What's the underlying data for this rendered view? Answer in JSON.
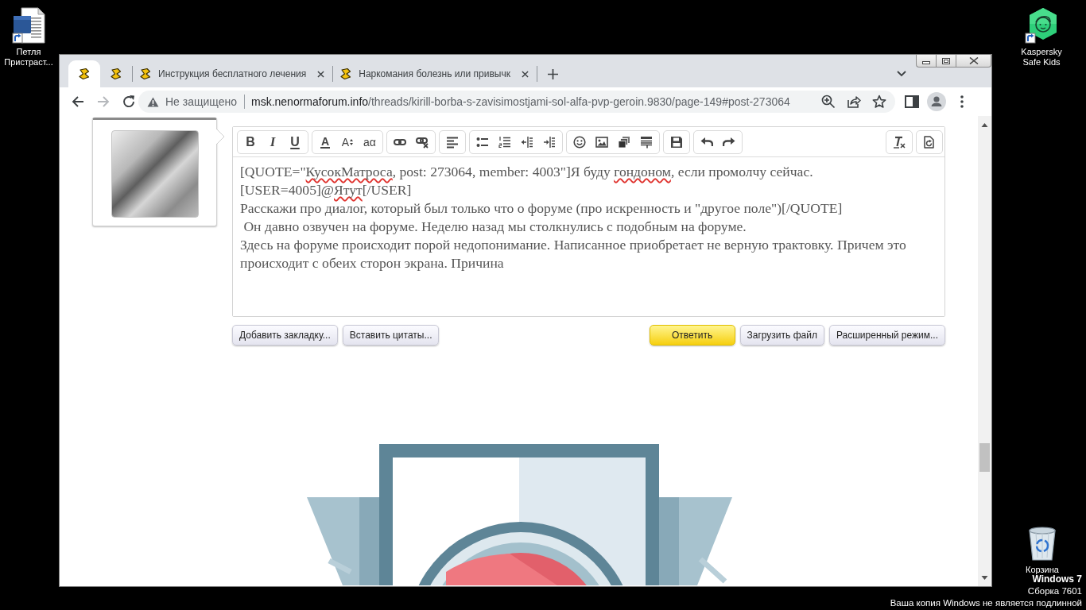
{
  "desktop": {
    "icons": [
      {
        "kind": "document",
        "label": "Петля Пристраст..."
      },
      {
        "kind": "app",
        "label": "Kaspersky Safe Kids"
      },
      {
        "kind": "trash",
        "label": "Корзина"
      }
    ],
    "notice": {
      "edition": "Windows 7",
      "build": "Сборка 7601",
      "warning": "Ваша копия Windows не является подлинной"
    }
  },
  "browser": {
    "tabs": [
      {
        "kind": "pinned",
        "selected": true
      },
      {
        "kind": "pinned",
        "selected": false
      },
      {
        "kind": "normal",
        "title": "Инструкция бесплатного лечения",
        "selected": false
      },
      {
        "kind": "normal",
        "title": "Наркомания болезнь или привычк",
        "selected": false
      }
    ],
    "forward_disabled": true,
    "address_bar": {
      "security_label": "Не защищено",
      "host": "msk.nenormaforum.info",
      "path": "/threads/kirill-borba-s-zavisimostjami-sol-alfa-pvp-geroin.9830/page-149#post-273064"
    }
  },
  "page": {
    "editor": {
      "toolbar": {
        "text_style": [
          "B",
          "I",
          "U"
        ],
        "font": [
          "A",
          "A",
          "aα"
        ]
      },
      "lines": [
        {
          "segments": [
            {
              "text": "[QUOTE=\"",
              "misspelled": false
            },
            {
              "text": "КусокМатроса",
              "misspelled": true
            },
            {
              "text": ", post: 273064, member: 4003\"]Я буду ",
              "misspelled": false
            },
            {
              "text": "гондоном",
              "misspelled": true
            },
            {
              "text": ", если промолчу сейчас.",
              "misspelled": false
            }
          ]
        },
        {
          "segments": [
            {
              "text": "[USER=4005]@",
              "misspelled": false
            },
            {
              "text": "Ятут",
              "misspelled": true
            },
            {
              "text": "[/USER]",
              "misspelled": false
            }
          ]
        },
        {
          "segments": [
            {
              "text": "Расскажи про диалог, который был только что о форуме (про искренность и \"другое поле\")[/QUOTE]",
              "misspelled": false
            }
          ]
        },
        {
          "segments": [
            {
              "text": " Он давно озвучен на форуме. Неделю назад мы столкнулись с подобным на форуме.",
              "misspelled": false
            }
          ]
        },
        {
          "segments": [
            {
              "text": "Здесь на форуме происходит порой недопонимание. Написанное приобретает не верную трактовку. Причем это происходит с обеих сторон экрана. Причина",
              "misspelled": false
            }
          ]
        }
      ]
    },
    "actions_left": [
      "Добавить закладку...",
      "Вставить цитаты..."
    ],
    "actions_right": [
      {
        "label": "Ответить",
        "kind": "primary"
      },
      {
        "label": "Загрузить файл",
        "kind": "secondary"
      },
      {
        "label": "Расширенный режим...",
        "kind": "secondary"
      }
    ]
  }
}
